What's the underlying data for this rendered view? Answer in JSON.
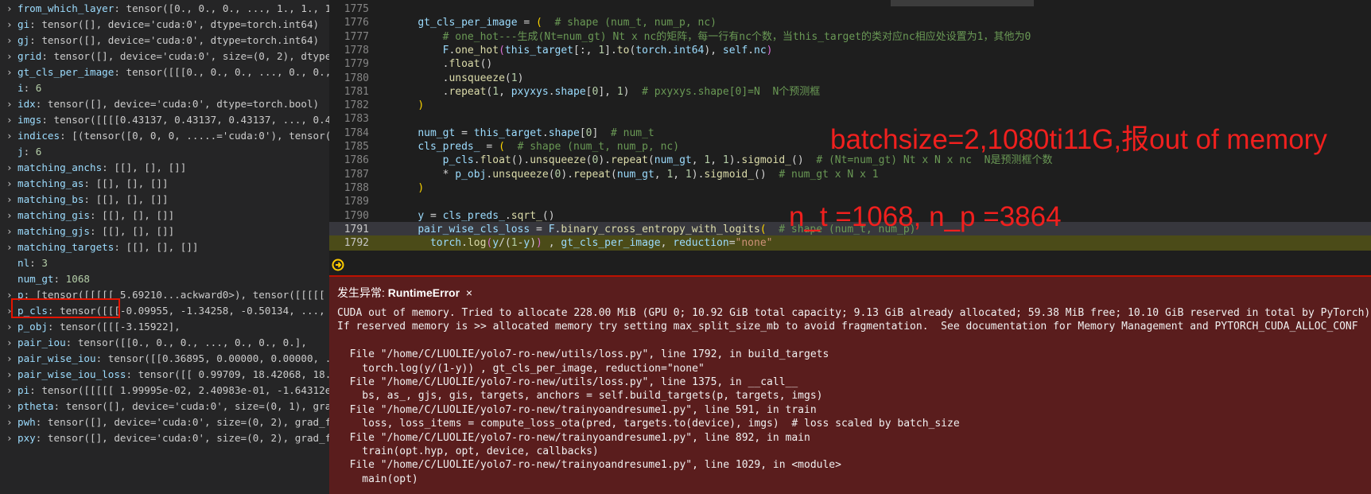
{
  "variables": [
    {
      "expand": true,
      "name": "from_which_layer",
      "value": "tensor([0., 0., 0.,  ..., 1., 1., 1..."
    },
    {
      "expand": true,
      "name": "gi",
      "value": "tensor([], device='cuda:0', dtype=torch.int64)"
    },
    {
      "expand": true,
      "name": "gj",
      "value": "tensor([], device='cuda:0', dtype=torch.int64)"
    },
    {
      "expand": true,
      "name": "grid",
      "value": "tensor([], device='cuda:0', size=(0, 2), dtype=..."
    },
    {
      "expand": true,
      "name": "gt_cls_per_image",
      "value": "tensor([[[0., 0., 0.,  ..., 0., 0.,..."
    },
    {
      "expand": false,
      "name": "i",
      "value": "6",
      "numeric": true
    },
    {
      "expand": true,
      "name": "idx",
      "value": "tensor([], device='cuda:0', dtype=torch.bool)"
    },
    {
      "expand": true,
      "name": "imgs",
      "value": "tensor([[[[0.43137, 0.43137, 0.43137,  ..., 0.4..."
    },
    {
      "expand": true,
      "name": "indices",
      "value": "[(tensor([0, 0, 0,  .....='cuda:0'), tensor(..."
    },
    {
      "expand": false,
      "name": "j",
      "value": "6",
      "numeric": true
    },
    {
      "expand": true,
      "name": "matching_anchs",
      "value": "[[], [], []]"
    },
    {
      "expand": true,
      "name": "matching_as",
      "value": "[[], [], []]"
    },
    {
      "expand": true,
      "name": "matching_bs",
      "value": "[[], [], []]"
    },
    {
      "expand": true,
      "name": "matching_gis",
      "value": "[[], [], []]"
    },
    {
      "expand": true,
      "name": "matching_gjs",
      "value": "[[], [], []]"
    },
    {
      "expand": true,
      "name": "matching_targets",
      "value": "[[], [], []]"
    },
    {
      "expand": false,
      "name": "nl",
      "value": "3",
      "numeric": true
    },
    {
      "expand": false,
      "name": "num_gt",
      "value": "1068",
      "numeric": true
    },
    {
      "expand": true,
      "name": "p",
      "value": "[tensor([[[[[ 5.69210...ackward0>), tensor([[[[[ 6..."
    },
    {
      "expand": true,
      "name": "p_cls",
      "value": "tensor([[[-0.09955, -1.34258, -0.50134,  ..., -..."
    },
    {
      "expand": true,
      "name": "p_obj",
      "value": "tensor([[[-3.15922],"
    },
    {
      "expand": true,
      "name": "pair_iou",
      "value": "tensor([[0., 0., 0.,  ..., 0., 0., 0.],"
    },
    {
      "expand": true,
      "name": "pair_wise_iou",
      "value": "tensor([[0.36895, 0.00000, 0.00000,  ..."
    },
    {
      "expand": true,
      "name": "pair_wise_iou_loss",
      "value": "tensor([[ 0.99709, 18.42068, 18.4..."
    },
    {
      "expand": true,
      "name": "pi",
      "value": "tensor([[[[[ 1.99995e-02,  2.40983e-01, -1.64312e..."
    },
    {
      "expand": true,
      "name": "ptheta",
      "value": "tensor([], device='cuda:0', size=(0, 1), grad..."
    },
    {
      "expand": true,
      "name": "pwh",
      "value": "tensor([], device='cuda:0', size=(0, 2), grad_fn..."
    },
    {
      "expand": true,
      "name": "pxy",
      "value": "tensor([], device='cuda:0', size=(0, 2), grad_fn..."
    }
  ],
  "code_lines": [
    {
      "ln": "1775",
      "html": ""
    },
    {
      "ln": "1776",
      "html": "    <span class='vr'>gt_cls_per_image</span> = <span class='br1'>(</span>  <span class='cm'># shape (num_t, num_p, nc)</span>"
    },
    {
      "ln": "1777",
      "html": "        <span class='cm'># one_hot---生成(Nt=num_gt) Nt x nc的矩阵，每一行有nc个数，当this_target的类对应nc相应处设置为1，其他为0</span>"
    },
    {
      "ln": "1778",
      "html": "        <span class='vr'>F</span>.<span class='fn'>one_hot</span><span class='br2'>(</span><span class='vr'>this_target</span>[:, <span class='nm'>1</span>].<span class='fn'>to</span>(<span class='vr'>torch</span>.<span class='vr'>int64</span>), <span class='vr'>self</span>.<span class='vr'>nc</span><span class='br2'>)</span>"
    },
    {
      "ln": "1779",
      "html": "        .<span class='fn'>float</span>()"
    },
    {
      "ln": "1780",
      "html": "        .<span class='fn'>unsqueeze</span>(<span class='nm'>1</span>)"
    },
    {
      "ln": "1781",
      "html": "        .<span class='fn'>repeat</span>(<span class='nm'>1</span>, <span class='vr'>pxyxys</span>.<span class='vr'>shape</span>[<span class='nm'>0</span>], <span class='nm'>1</span>)  <span class='cm'># pxyxys.shape[0]=N  N个预测框</span>"
    },
    {
      "ln": "1782",
      "html": "    <span class='br1'>)</span>"
    },
    {
      "ln": "1783",
      "html": ""
    },
    {
      "ln": "1784",
      "html": "    <span class='vr'>num_gt</span> = <span class='vr'>this_target</span>.<span class='vr'>shape</span>[<span class='nm'>0</span>]  <span class='cm'># num_t</span>"
    },
    {
      "ln": "1785",
      "html": "    <span class='vr'>cls_preds_</span> = <span class='br1'>(</span>  <span class='cm'># shape (num_t, num_p, nc)</span>"
    },
    {
      "ln": "1786",
      "html": "        <span class='vr'>p_cls</span>.<span class='fn'>float</span>().<span class='fn'>unsqueeze</span>(<span class='nm'>0</span>).<span class='fn'>repeat</span>(<span class='vr'>num_gt</span>, <span class='nm'>1</span>, <span class='nm'>1</span>).<span class='fn'>sigmoid_</span>()  <span class='cm'># (Nt=num_gt) Nt x N x nc  N是预测框个数</span>"
    },
    {
      "ln": "1787",
      "html": "        * <span class='vr'>p_obj</span>.<span class='fn'>unsqueeze</span>(<span class='nm'>0</span>).<span class='fn'>repeat</span>(<span class='vr'>num_gt</span>, <span class='nm'>1</span>, <span class='nm'>1</span>).<span class='fn'>sigmoid_</span>()  <span class='cm'># num_gt x N x 1</span>"
    },
    {
      "ln": "1788",
      "html": "    <span class='br1'>)</span>"
    },
    {
      "ln": "1789",
      "html": ""
    },
    {
      "ln": "1790",
      "html": "    <span class='vr'>y</span> = <span class='vr'>cls_preds_</span>.<span class='fn'>sqrt_</span>()"
    },
    {
      "ln": "1791",
      "html": "    <span class='vr'>pair_wise_cls_loss</span> = <span class='vr'>F</span>.<span class='fn'>binary_cross_entropy_with_logits</span><span class='br1'>(</span>  <span class='cm'># shape (num_t, num_p)</span>",
      "current": true
    },
    {
      "ln": "1792",
      "html": "      <span class='vr'>torch</span>.<span class='fn'>log</span><span class='br2'>(</span><span class='vr'>y</span>/(<span class='nm'>1</span>-<span class='vr'>y</span>)<span class='br2'>)</span> , <span class='vr'>gt_cls_per_image</span>, <span class='vr'>reduction</span>=<span class='st'>\"none\"</span>",
      "exec": true
    }
  ],
  "annotations": {
    "line1": "batchsize=2,1080ti11G,报out of memory",
    "line2": "n_t =1068, n_p =3864"
  },
  "exception": {
    "prefix": "发生异常: ",
    "type": "RuntimeError",
    "close": "×",
    "lines": [
      "CUDA out of memory. Tried to allocate 228.00 MiB (GPU 0; 10.92 GiB total capacity; 9.13 GiB already allocated; 59.38 MiB free; 10.10 GiB reserved in total by PyTorch)",
      "If reserved memory is >> allocated memory try setting max_split_size_mb to avoid fragmentation.  See documentation for Memory Management and PYTORCH_CUDA_ALLOC_CONF",
      "",
      "  File \"/home/C/LUOLIE/yolo7-ro-new/utils/loss.py\", line 1792, in build_targets",
      "    torch.log(y/(1-y)) , gt_cls_per_image, reduction=\"none\"",
      "  File \"/home/C/LUOLIE/yolo7-ro-new/utils/loss.py\", line 1375, in __call__",
      "    bs, as_, gjs, gis, targets, anchors = self.build_targets(p, targets, imgs)",
      "  File \"/home/C/LUOLIE/yolo7-ro-new/trainyoandresume1.py\", line 591, in train",
      "    loss, loss_items = compute_loss_ota(pred, targets.to(device), imgs)  # loss scaled by batch_size",
      "  File \"/home/C/LUOLIE/yolo7-ro-new/trainyoandresume1.py\", line 892, in main",
      "    train(opt.hyp, opt, device, callbacks)",
      "  File \"/home/C/LUOLIE/yolo7-ro-new/trainyoandresume1.py\", line 1029, in <module>",
      "    main(opt)"
    ]
  },
  "colors": {
    "accent_red": "#e51400",
    "exception_bg": "#5a1d1d",
    "exec_line_bg": "#4b4b18"
  },
  "icons": {
    "chevron": "chevron-right-icon",
    "exec_pointer": "breakpoint-arrow-icon"
  }
}
